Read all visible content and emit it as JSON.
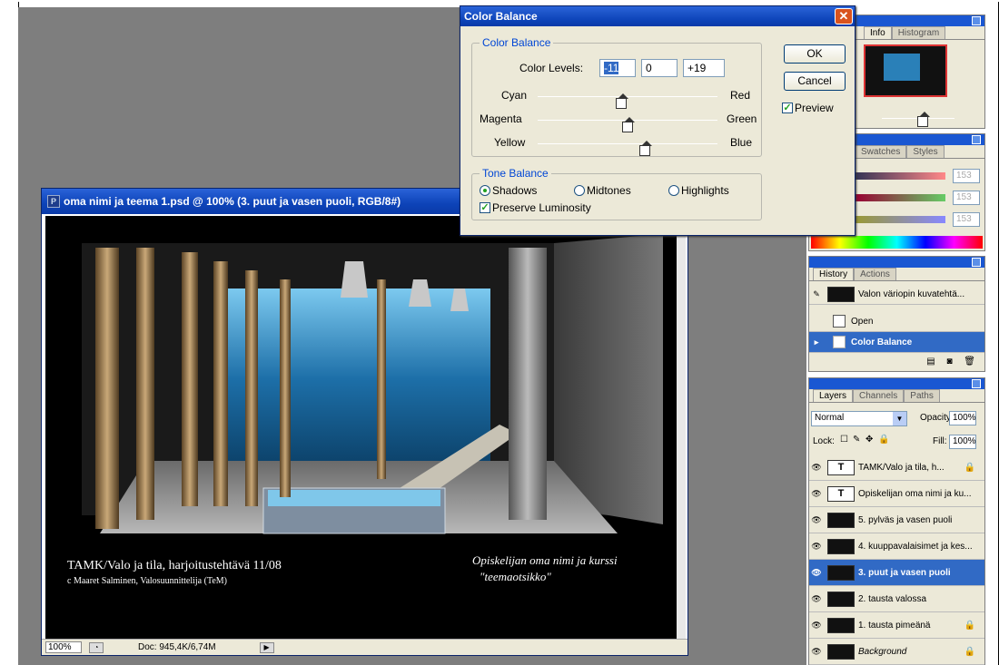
{
  "dialog": {
    "title": "Color Balance",
    "close_glyph": "✕",
    "group_color": "Color Balance",
    "color_levels_label": "Color Levels:",
    "levels": [
      "-11",
      "0",
      "+19"
    ],
    "sliders": [
      {
        "left": "Cyan",
        "right": "Red",
        "value": -11
      },
      {
        "left": "Magenta",
        "right": "Green",
        "value": 0
      },
      {
        "left": "Yellow",
        "right": "Blue",
        "value": 19
      }
    ],
    "group_tone": "Tone Balance",
    "tone_options": [
      "Shadows",
      "Midtones",
      "Highlights"
    ],
    "tone_selected": "Shadows",
    "preserve_luminosity": "Preserve Luminosity",
    "ok": "OK",
    "cancel": "Cancel",
    "preview": "Preview"
  },
  "document": {
    "title": "oma nimi ja teema 1.psd @ 100% (3. puut ja vasen puoli, RGB/8#)",
    "zoom": "100%",
    "doc_size": "Doc: 945,4K/6,74M",
    "caption_left": "TAMK/Valo ja tila, harjoitustehtävä 11/08",
    "caption_left_sub": "c Maaret Salminen, Valosuunnittelija (TeM)",
    "caption_right_1": "Opiskelijan oma nimi ja kurssi",
    "caption_right_2": "\"teemaotsikko\""
  },
  "navigator": {
    "tabs": [
      "Info",
      "Histogram"
    ]
  },
  "color": {
    "tabs": [
      "Swatches",
      "Styles"
    ],
    "values": [
      "153",
      "153",
      "153"
    ]
  },
  "history": {
    "tabs": [
      "History",
      "Actions"
    ],
    "snapshot": "Valon väriopin kuvatehtä...",
    "items": [
      "Open",
      "Color Balance"
    ],
    "selected": "Color Balance"
  },
  "layers": {
    "tabs": [
      "Layers",
      "Channels",
      "Paths"
    ],
    "blend_mode": "Normal",
    "opacity_label": "Opacity:",
    "opacity": "100%",
    "lock_label": "Lock:",
    "fill_label": "Fill:",
    "fill": "100%",
    "items": [
      {
        "name": "TAMK/Valo ja tila, h...",
        "type": "text",
        "locked": true
      },
      {
        "name": "Opiskelijan oma nimi ja ku...",
        "type": "text",
        "locked": false
      },
      {
        "name": "5. pylväs ja vasen puoli",
        "type": "image",
        "locked": false
      },
      {
        "name": "4. kuuppavalaisimet ja kes...",
        "type": "image",
        "locked": false
      },
      {
        "name": "3. puut ja vasen puoli",
        "type": "image",
        "locked": false
      },
      {
        "name": "2. tausta valossa",
        "type": "image",
        "locked": false
      },
      {
        "name": "1. tausta pimeänä",
        "type": "image",
        "locked": true
      },
      {
        "name": "Background",
        "type": "image",
        "locked": true
      }
    ],
    "selected": "3. puut ja vasen puoli"
  },
  "colors": {
    "title_blue": "#0d43b8",
    "selection": "#316ac5",
    "panel_bg": "#ece9d8"
  }
}
